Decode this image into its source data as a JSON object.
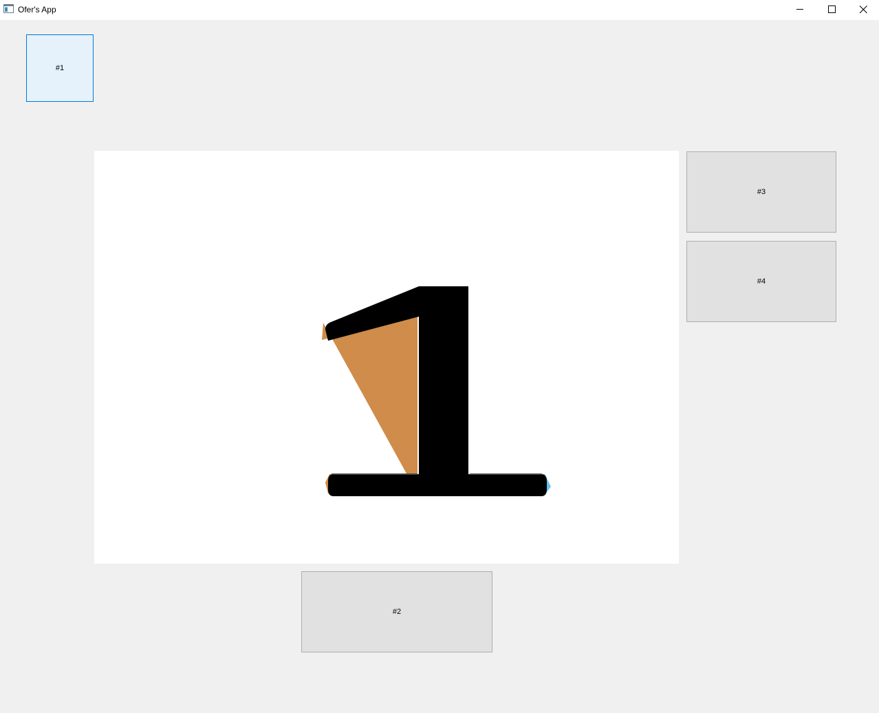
{
  "window": {
    "title": "Ofer's App",
    "icon": "app-window-icon",
    "controls": [
      "minimize-icon",
      "maximize-icon",
      "close-icon"
    ]
  },
  "buttons": {
    "b1": "#1",
    "b2": "#2",
    "b3": "#3",
    "b4": "#4"
  },
  "display": {
    "value": "1"
  }
}
